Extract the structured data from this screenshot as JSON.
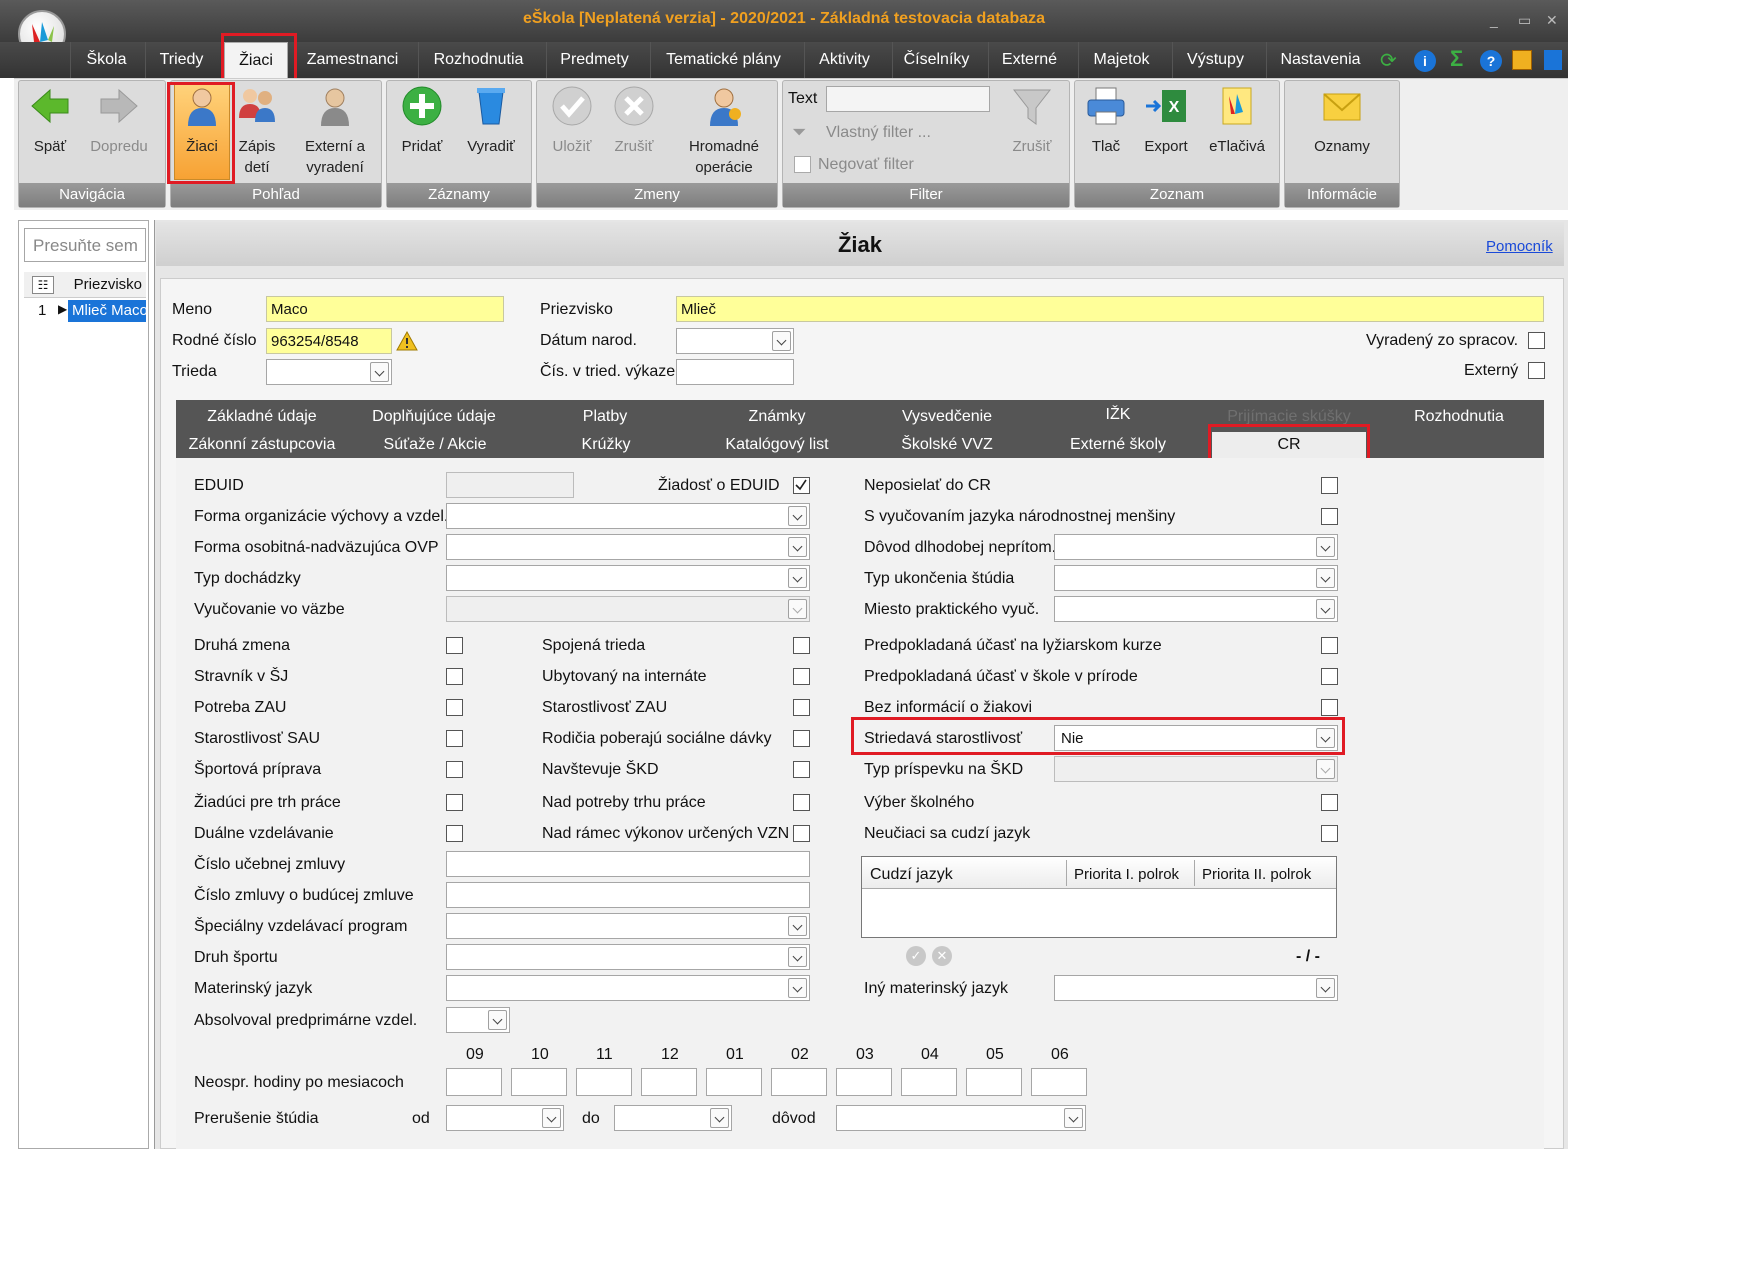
{
  "window": {
    "title": "eŠkola [Neplatená verzia] - 2020/2021 - Základná testovacia databaza"
  },
  "menu": {
    "items": [
      "Škola",
      "Triedy",
      "Žiaci",
      "Zamestnanci",
      "Rozhodnutia",
      "Predmety",
      "Tematické plány",
      "Aktivity",
      "Číselníky",
      "Externé",
      "Majetok",
      "Výstupy",
      "Nastavenia"
    ],
    "active": "Žiaci"
  },
  "ribbon": {
    "navigacia": {
      "label": "Navigácia",
      "spat": "Späť",
      "dopredu": "Dopredu"
    },
    "pohlad": {
      "label": "Pohľad",
      "ziaci": "Žiaci",
      "zapis_1": "Zápis",
      "zapis_2": "detí",
      "externi_1": "Externí a",
      "externi_2": "vyradení"
    },
    "zaznamy": {
      "label": "Záznamy",
      "pridat": "Pridať",
      "vyradit": "Vyradiť"
    },
    "zmeny": {
      "label": "Zmeny",
      "ulozit": "Uložiť",
      "zrusit": "Zrušiť",
      "hromadne_1": "Hromadné",
      "hromadne_2": "operácie"
    },
    "filter": {
      "label": "Filter",
      "text": "Text",
      "vlastny": "Vlastný filter ...",
      "negovat": "Negovať filter",
      "zrusit": "Zrušiť"
    },
    "zoznam": {
      "label": "Zoznam",
      "tlac": "Tlač",
      "export": "Export",
      "etlaciva": "eTlačivá"
    },
    "informacie": {
      "label": "Informácie",
      "oznamy": "Oznamy"
    }
  },
  "left": {
    "search_placeholder": "Presuňte sem",
    "col": "Priezvisko",
    "row_num": "1",
    "row_name": "Mlieč Maco"
  },
  "main": {
    "title": "Žiak",
    "helper": "Pomocník"
  },
  "student": {
    "meno_label": "Meno",
    "meno": "Maco",
    "priezvisko_label": "Priezvisko",
    "priezvisko": "Mlieč",
    "rc_label": "Rodné číslo",
    "rc": "963254/8548",
    "datum_label": "Dátum narod.",
    "vyradeny_label": "Vyradený zo spracov.",
    "trieda_label": "Trieda",
    "cis_label": "Čís. v tried. výkaze",
    "externy_label": "Externý"
  },
  "tabs": {
    "row1": [
      "Základné údaje",
      "Doplňujúce údaje",
      "Platby",
      "Známky",
      "Vysvedčenie",
      "IŽK",
      "Prijímacie skúšky",
      "Rozhodnutia"
    ],
    "row2": [
      "Zákonní zástupcovia",
      "Súťaže / Akcie",
      "Krúžky",
      "Katalógový list",
      "Školské VVZ",
      "Externé školy",
      "CR"
    ],
    "active": "CR",
    "disabled": "Prijímacie skúšky"
  },
  "cr": {
    "eduid": "EDUID",
    "ziadost_eduid": "Žiadosť o EDUID",
    "forma_org": "Forma organizácie výchovy a vzdel.",
    "forma_osob": "Forma osobitná-nadväzujúca OVP",
    "typ_dochadzky": "Typ dochádzky",
    "vyucovanie_vazbe": "Vyučovanie vo väzbe",
    "druha_zmena": "Druhá zmena",
    "stravnik": "Stravník v ŠJ",
    "potreba_zau": "Potreba ZAU",
    "starost_sau": "Starostlivosť SAU",
    "sportova": "Športová príprava",
    "ziadu_trh": "Žiadúci pre trh práce",
    "dualne": "Duálne vzdelávanie",
    "spojena": "Spojená trieda",
    "ubytovany": "Ubytovaný na internáte",
    "starost_zau": "Starostlivosť ZAU",
    "rodicia": "Rodičia poberajú sociálne dávky",
    "navstevuje": "Navštevuje ŠKD",
    "nad_potreby": "Nad potreby trhu práce",
    "nad_ramec": "Nad rámec výkonov určených VZN",
    "cislo_ucebnej": "Číslo učebnej zmluvy",
    "cislo_zmluvy": "Číslo zmluvy o budúcej zmluve",
    "specialny": "Špeciálny vzdelávací program",
    "druh_sportu": "Druh športu",
    "materinsky": "Materinský jazyk",
    "absolvoval": "Absolvoval predprimárne vzdel.",
    "neposielat": "Neposielať do CR",
    "s_vyucovanim": "S vyučovaním jazyka národnostnej menšiny",
    "dovod_dlhodobej": "Dôvod dlhodobej neprítom.",
    "typ_ukoncenia": "Typ ukončenia štúdia",
    "miesto_prakt": "Miesto praktického vyuč.",
    "lyziarsky": "Predpokladaná účasť na lyžiarskom kurze",
    "skola_prirode": "Predpokladaná účasť v škole v prírode",
    "bez_info": "Bez informácií o žiakovi",
    "striedava": "Striedavá starostlivosť",
    "striedava_value": "Nie",
    "typ_prispevku": "Typ príspevku na ŠKD",
    "vyber_skolneho": "Výber školného",
    "neuciaci": "Neučiaci sa cudzí jazyk",
    "cudzi_cols": [
      "Cudzí jazyk",
      "Priorita I. polrok",
      "Priorita II. polrok"
    ],
    "pager": "- / -",
    "iny_materinsky": "Iný materinský jazyk",
    "mesiace": [
      "09",
      "10",
      "11",
      "12",
      "01",
      "02",
      "03",
      "04",
      "05",
      "06"
    ],
    "neospr": "Neospr. hodiny po mesiacoch",
    "prerusenie": "Prerušenie štúdia",
    "od": "od",
    "do": "do",
    "dovod": "dôvod"
  },
  "colors": {
    "accent_red": "#e01b24",
    "title_orange": "#f0a020",
    "required_yellow": "#ffff99",
    "selection_blue": "#1a74d8"
  }
}
